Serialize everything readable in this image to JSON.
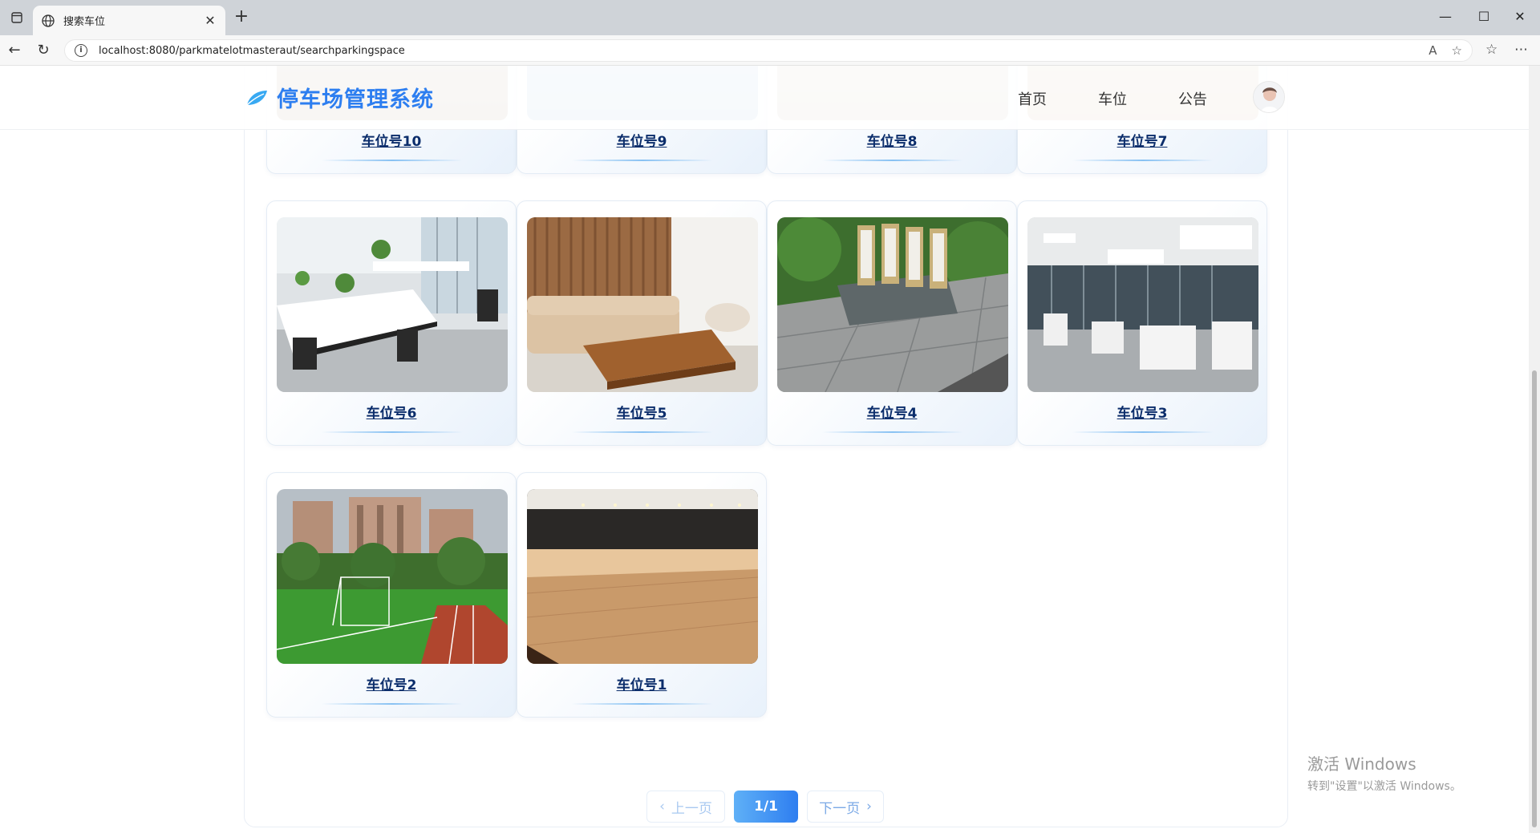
{
  "browser": {
    "tab_title": "搜索车位",
    "url": "localhost:8080/parkmatelotmasteraut/searchparkingspace"
  },
  "header": {
    "brand": "停车场管理系统",
    "nav": [
      "首页",
      "车位",
      "公告"
    ]
  },
  "cards": [
    {
      "name": "车位号10"
    },
    {
      "name": "车位号9"
    },
    {
      "name": "车位号8"
    },
    {
      "name": "车位号7"
    },
    {
      "name": "车位号6"
    },
    {
      "name": "车位号5"
    },
    {
      "name": "车位号4"
    },
    {
      "name": "车位号3"
    },
    {
      "name": "车位号2"
    },
    {
      "name": "车位号1"
    }
  ],
  "pagination": {
    "prev": "上一页",
    "current": "1/1",
    "next": "下一页"
  },
  "watermark": {
    "line1": "激活 Windows",
    "line2": "转到\"设置\"以激活 Windows。"
  },
  "colors": {
    "brand": "#2d7ef0",
    "card_title": "#0b2d6b"
  }
}
